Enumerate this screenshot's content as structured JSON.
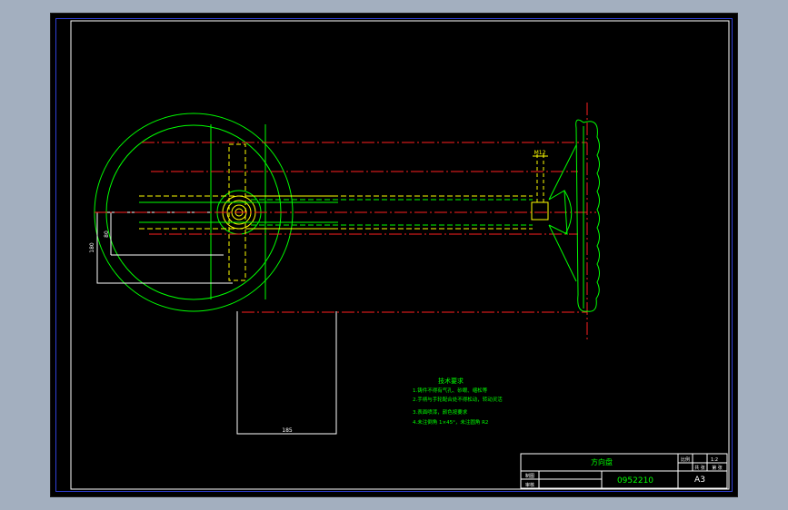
{
  "drawing": {
    "dimensions": {
      "dim_left_outer": "180",
      "dim_left_inner": "80",
      "dim_bottom": "185",
      "dim_right_small": "M12"
    },
    "notes": {
      "title": "技术要求",
      "lines": [
        "1.铸件不得有气孔、砂眼、缩松等",
        "2.手柄与手轮配合处不得松动，转动灵活",
        "3.表面喷漆，颜色按要求",
        "4.未注倒角 1×45°，未注圆角 R2"
      ]
    },
    "title_block": {
      "part_name": "方向盘",
      "drawing_number": "0952210",
      "sheet_size": "A3",
      "scale_label": "比例",
      "scale_value": "1:2",
      "sheet_label": "共 张",
      "sheet_count": "第 张",
      "drawn_label": "制图",
      "checked_label": "审核"
    }
  },
  "colors": {
    "background": "#000000",
    "outer_frame": "#ffffff",
    "inner_border": "#2f3fd6",
    "green_lines": "#00ff00",
    "red_centerlines": "#ff2020",
    "yellow_hidden": "#ffff00",
    "white_lines": "#ffffff"
  }
}
